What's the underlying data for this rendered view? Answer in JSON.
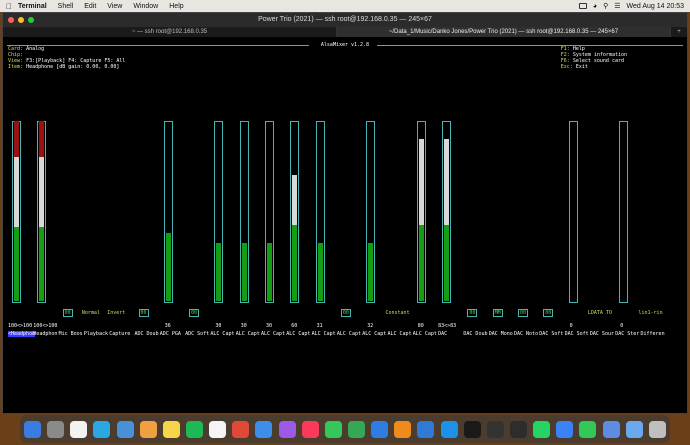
{
  "menubar": {
    "app": "Terminal",
    "items": [
      "Shell",
      "Edit",
      "View",
      "Window",
      "Help"
    ],
    "clock": "Wed Aug 14  20:53"
  },
  "window": {
    "title": "Power Trio (2021) — ssh root@192.168.0.35 — 245×67",
    "tabs": [
      "~ — ssh root@192.168.0.35",
      "~/Data_1/Music/Danko Jones/Power Trio (2021) — ssh root@192.168.0.35 — 245×67"
    ],
    "active_tab": 1
  },
  "alsamixer": {
    "title": "AlsaMixer v1.2.8",
    "card_label": "Card:",
    "card": "Analog",
    "chip_label": "Chip:",
    "chip": "",
    "view_label": "View:",
    "view": "F3:[Playback] F4: Capture  F5: All",
    "item_label": "Item:",
    "item": "Headphone [dB gain: 0.00, 0.00]",
    "help": [
      {
        "key": "F1:",
        "text": "Help"
      },
      {
        "key": "F2:",
        "text": "System information"
      },
      {
        "key": "F6:",
        "text": "Select sound card"
      },
      {
        "key": "Esc:",
        "text": "Exit"
      }
    ],
    "channels": [
      {
        "name": "<Headphon",
        "vol": "100<>100",
        "selected": true,
        "red": 1,
        "white": 1,
        "green": 1
      },
      {
        "name": "Headphon",
        "vol": "100<>100",
        "red": 1,
        "white": 1,
        "green": 1
      },
      {
        "name": "Mic Boos",
        "switch": "00"
      },
      {
        "name": "Playback",
        "misc": "Normal"
      },
      {
        "name": "Capture",
        "misc": "Invert"
      },
      {
        "name": "ADC Doub",
        "switch": "00"
      },
      {
        "name": "ADC PGA",
        "vol": "36",
        "green": 0.38
      },
      {
        "name": "ADC Soft",
        "switch": "00"
      },
      {
        "name": "ALC Capt",
        "vol": "30",
        "green": 0.32
      },
      {
        "name": "ALC Capt",
        "vol": "30",
        "green": 0.32
      },
      {
        "name": "ALC Capt",
        "vol": "30",
        "green": 0.32
      },
      {
        "name": "ALC Capt",
        "vol": "60",
        "white": 0.28,
        "green": 0.42
      },
      {
        "name": "ALC Capt",
        "vol": "31",
        "green": 0.32
      },
      {
        "name": "ALC Capt",
        "switch": "00"
      },
      {
        "name": "ALC Capt",
        "vol": "32",
        "green": 0.32
      },
      {
        "name": "ALC Capt",
        "misc": "Constant"
      },
      {
        "name": "ALC Capt",
        "vol": "80",
        "white": 0.48,
        "green": 0.42
      },
      {
        "name": "DAC",
        "vol": "83<>83",
        "white": 0.48,
        "green": 0.42
      },
      {
        "name": "DAC Doub",
        "switch": "00"
      },
      {
        "name": "DAC Mono",
        "switch": "MM"
      },
      {
        "name": "DAC Noto",
        "switch": "00"
      },
      {
        "name": "DAC Soft",
        "switch": "00"
      },
      {
        "name": "DAC Soft",
        "vol": "0"
      },
      {
        "name": "DAC Sour",
        "misc": "LDATA TO"
      },
      {
        "name": "DAC Ster",
        "vol": "0"
      },
      {
        "name": "Differen",
        "misc": "lin1-rin"
      }
    ]
  },
  "dock": {
    "apps": [
      "Finder",
      "Launchpad",
      "Calendar",
      "Skype",
      "Preview",
      "Photos",
      "Notes",
      "Spotify",
      "Reminders",
      "Chrome",
      "Mail",
      "Podcasts",
      "Music",
      "Messages",
      "Numbers",
      "Keynote",
      "VLC",
      "VS Code",
      "Docker",
      "Terminal",
      "Kindle",
      "Activity",
      "WhatsApp",
      "Messenger",
      "FaceTime",
      "Preview2",
      "Finder2",
      "Trash"
    ],
    "colors": [
      "#3a7de0",
      "#8a8a8a",
      "#f2f2f2",
      "#2ba7e2",
      "#4a90d9",
      "#f0a040",
      "#f6d54a",
      "#1db954",
      "#f5f5f5",
      "#e04838",
      "#3d8ee8",
      "#9b59e6",
      "#fb3a5a",
      "#35c759",
      "#34a853",
      "#2f7de1",
      "#f08a1c",
      "#2f7ad6",
      "#1d91e6",
      "#1a1a1a",
      "#333333",
      "#2d2d2d",
      "#25d366",
      "#3b82f6",
      "#34c759",
      "#5e8ce0",
      "#6aa8f0",
      "#bfbfbf"
    ]
  }
}
